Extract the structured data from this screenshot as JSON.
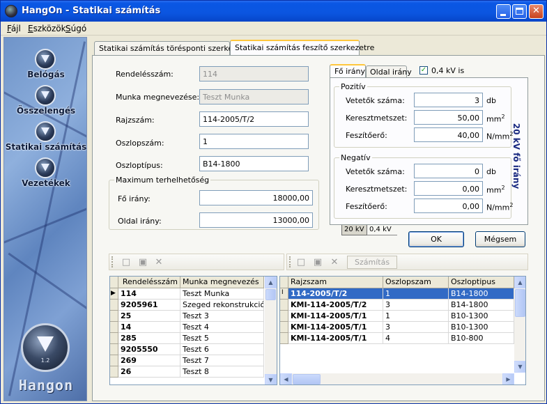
{
  "window": {
    "title": "HangOn - Statikai számítás"
  },
  "menu": {
    "items": [
      {
        "hotkey": "F",
        "rest": "ájl"
      },
      {
        "hotkey": "E",
        "rest": "szközök"
      },
      {
        "hotkey": "S",
        "rest": "úgó"
      }
    ]
  },
  "sidebar": {
    "items": [
      {
        "label": "Belógás",
        "icon": "belogas-icon"
      },
      {
        "label": "Összelengés",
        "icon": "osszelenges-icon"
      },
      {
        "label": "Statikai számítás",
        "icon": "statikai-icon"
      },
      {
        "label": "Vezetékek",
        "icon": "vezetekek-icon"
      }
    ],
    "logo_text": "Hangon",
    "logo_version": "1.2"
  },
  "tabs": [
    {
      "label": "Statikai számítás törésponti szerkezetre",
      "active": false
    },
    {
      "label": "Statikai számítás feszítő szerkezetre",
      "active": true
    }
  ],
  "form": {
    "rendelesszam": {
      "label": "Rendelésszám:",
      "value": "114"
    },
    "munka": {
      "label": "Munka megnevezése:",
      "value": "Teszt Munka"
    },
    "rajzszam": {
      "label": "Rajzszám:",
      "value": "114-2005/T/2"
    },
    "oszlopszam": {
      "label": "Oszlopszám:",
      "value": "1"
    },
    "oszloptipus": {
      "label": "Oszloptípus:",
      "value": "B14-1800"
    },
    "max_group": {
      "title": "Maximum terhelhetőség",
      "fo_label": "Fő irány:",
      "fo_value": "18000,00",
      "oldal_label": "Oldal irány:",
      "oldal_value": "13000,00"
    }
  },
  "direction": {
    "tabs": [
      "Fő irány",
      "Oldal irány"
    ],
    "checkbox_label": "0,4 kV is",
    "checkbox_checked": true,
    "vertical_label": "20 kV fő irány",
    "pozitiv": {
      "title": "Pozitív",
      "vetetok_label": "Vetetők száma:",
      "vetetok_value": "3",
      "vetetok_unit": "db",
      "kereszt_label": "Keresztmetszet:",
      "kereszt_value": "50,00",
      "kereszt_unit": "mm",
      "kereszt_exp": "2",
      "feszito_label": "Feszítőerő:",
      "feszito_value": "40,00",
      "feszito_unit": "N/mm",
      "feszito_exp": "2"
    },
    "negativ": {
      "title": "Negatív",
      "vetetok_label": "Vetetők száma:",
      "vetetok_value": "0",
      "vetetok_unit": "db",
      "kereszt_label": "Keresztmetszet:",
      "kereszt_value": "0,00",
      "kereszt_unit": "mm",
      "kereszt_exp": "2",
      "feszito_label": "Feszítőerő:",
      "feszito_value": "0,00",
      "feszito_unit": "N/mm",
      "feszito_exp": "2"
    },
    "voltage_tabs": [
      "20 kV",
      "0,4 kV"
    ]
  },
  "buttons": {
    "ok": "OK",
    "cancel": "Mégsem",
    "szamitas": "Számítás"
  },
  "left_grid": {
    "headers": [
      "Rendelésszám",
      "Munka megnevezés"
    ],
    "rows": [
      [
        "114",
        "Teszt Munka"
      ],
      [
        "9205961",
        "Szeged rekonstrukció"
      ],
      [
        "25",
        "Teszt 3"
      ],
      [
        "14",
        "Teszt 4"
      ],
      [
        "285",
        "Teszt 5"
      ],
      [
        "9205550",
        "Teszt 6"
      ],
      [
        "269",
        "Teszt 7"
      ],
      [
        "26",
        "Teszt 8"
      ]
    ]
  },
  "right_grid": {
    "headers": [
      "Rajzszam",
      "Oszlopszam",
      "Oszloptipus"
    ],
    "rows": [
      [
        "114-2005/T/2",
        "1",
        "B14-1800"
      ],
      [
        "KMI-114-2005/T/2",
        "3",
        "B14-1800"
      ],
      [
        "KMI-114-2005/T/1",
        "1",
        "B10-1300"
      ],
      [
        "KMI-114-2005/T/1",
        "3",
        "B10-1300"
      ],
      [
        "KMI-114-2005/T/1",
        "4",
        "B10-800"
      ]
    ]
  },
  "colors": {
    "titlebar": "#0a57e4",
    "selection": "#316ac5",
    "accent_tab": "#ffc73c"
  }
}
